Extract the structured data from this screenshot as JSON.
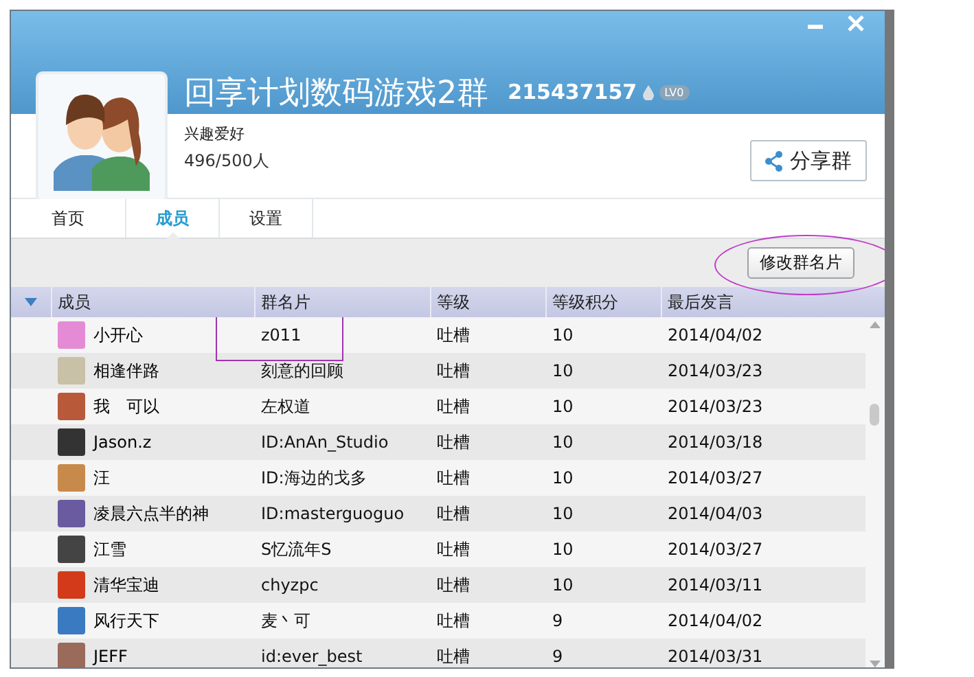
{
  "group": {
    "name": "回享计划数码游戏2群",
    "number": "215437157",
    "level_badge": "LV0",
    "category": "兴趣爱好",
    "member_count": "496/500人",
    "share_button": "分享群"
  },
  "tabs": [
    {
      "label": "首页",
      "selected": false
    },
    {
      "label": "成员",
      "selected": true
    },
    {
      "label": "设置",
      "selected": false
    }
  ],
  "toolbar": {
    "button": "修改群名片",
    "highlighted": true
  },
  "table": {
    "columns": [
      "成员",
      "群名片",
      "等级",
      "等级积分",
      "最后发言"
    ],
    "rows": [
      {
        "member": "小开心",
        "card": "z011",
        "level": "吐槽",
        "points": "10",
        "last_post": "2014/04/02",
        "highlighted": true
      },
      {
        "member": "相逢伴路",
        "card": "刻意的回顾",
        "level": "吐槽",
        "points": "10",
        "last_post": "2014/03/23",
        "highlighted": false
      },
      {
        "member": "我　可以",
        "card": "左权道",
        "level": "吐槽",
        "points": "10",
        "last_post": "2014/03/23",
        "highlighted": false
      },
      {
        "member": "Jason.z",
        "card": "ID:AnAn_Studio",
        "level": "吐槽",
        "points": "10",
        "last_post": "2014/03/18",
        "highlighted": false
      },
      {
        "member": "汪",
        "card": "ID:海边的戈多",
        "level": "吐槽",
        "points": "10",
        "last_post": "2014/03/27",
        "highlighted": false
      },
      {
        "member": "凌晨六点半的神",
        "card": "ID:masterguoguo",
        "level": "吐槽",
        "points": "10",
        "last_post": "2014/04/03",
        "highlighted": false
      },
      {
        "member": "江雪",
        "card": "S忆流年S",
        "level": "吐槽",
        "points": "10",
        "last_post": "2014/03/27",
        "highlighted": false
      },
      {
        "member": "清华宝迪",
        "card": "chyzpc",
        "level": "吐槽",
        "points": "10",
        "last_post": "2014/03/11",
        "highlighted": false
      },
      {
        "member": "风行天下",
        "card": "麦丶可",
        "level": "吐槽",
        "points": "9",
        "last_post": "2014/04/02",
        "highlighted": false
      },
      {
        "member": "JEFF",
        "card": "id:ever_best",
        "level": "吐槽",
        "points": "9",
        "last_post": "2014/03/31",
        "highlighted": false
      }
    ]
  }
}
